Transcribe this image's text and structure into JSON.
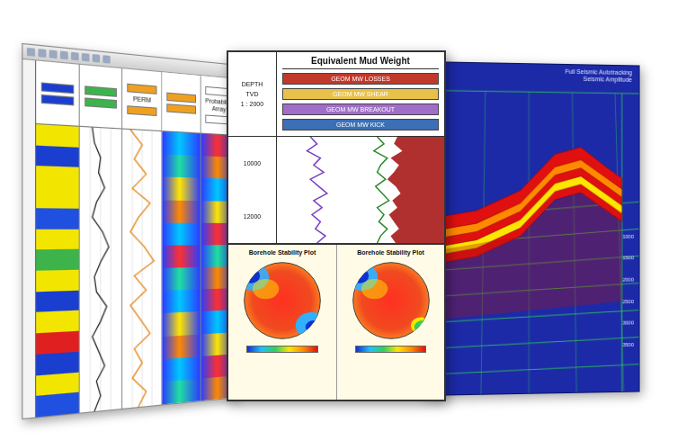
{
  "log_window": {
    "tracks": [
      {
        "kind": "facies",
        "label": "",
        "header_color": "#1a3fd0",
        "colors": [
          "#f2e600",
          "#1a3fd0",
          "#f2e600",
          "#f2e600",
          "#2050e0",
          "#f2e600",
          "#3cb44b",
          "#f2e600",
          "#1a3fd0",
          "#f2e600",
          "#e02020",
          "#1a3fd0",
          "#f2e600",
          "#2050e0"
        ]
      },
      {
        "kind": "curve",
        "label": "",
        "header_color": "#3cb44b",
        "color": "#222222",
        "values": [
          0.3,
          0.35,
          0.5,
          0.45,
          0.6,
          0.4,
          0.3,
          0.55,
          0.7,
          0.5,
          0.35,
          0.4,
          0.65,
          0.5,
          0.3,
          0.45,
          0.6,
          0.4,
          0.5,
          0.35
        ]
      },
      {
        "kind": "curve",
        "label": "PERM",
        "header_color": "#f0a020",
        "color": "#e07a00",
        "values": [
          0.2,
          0.5,
          0.3,
          0.6,
          0.25,
          0.7,
          0.4,
          0.2,
          0.55,
          0.8,
          0.3,
          0.6,
          0.2,
          0.45,
          0.7,
          0.3,
          0.5,
          0.25,
          0.6,
          0.4
        ]
      },
      {
        "kind": "heat",
        "label": "",
        "header_color": "#f0a020",
        "colors": [
          "#00c8ff",
          "#20e0a0",
          "#ffe600",
          "#ff8a00",
          "#00c8ff",
          "#ff3030",
          "#20e0a0",
          "#00c8ff",
          "#ffe600",
          "#ff8a00",
          "#00c8ff",
          "#20e0a0"
        ]
      },
      {
        "kind": "heat",
        "label": "Probability Array",
        "header_color": "#ffffff",
        "colors": [
          "#ff3030",
          "#ff8a00",
          "#00c8ff",
          "#ffe600",
          "#ff3030",
          "#20e0a0",
          "#ff8a00",
          "#ff3030",
          "#00c8ff",
          "#ffe600",
          "#ff3030",
          "#ff8a00"
        ]
      }
    ]
  },
  "mud_weight_window": {
    "title": "Equivalent Mud Weight",
    "depth_label": "DEPTH",
    "tvd_label": "TVD",
    "scale": "1 : 2000",
    "legend": [
      {
        "label": "GEOM MW LOSSES",
        "color": "#c0392b"
      },
      {
        "label": "GEOM MW SHEAR",
        "color": "#e8c14a"
      },
      {
        "label": "GEOM MW BREAKOUT",
        "color": "#a06ec8"
      },
      {
        "label": "GEOM MW KICK",
        "color": "#3b6fb6"
      }
    ],
    "depth_ticks": [
      "10000",
      "12000"
    ],
    "series": [
      {
        "kind": "fill",
        "color": "#b03030",
        "values": [
          0.72,
          0.7,
          0.75,
          0.68,
          0.73,
          0.7,
          0.66,
          0.71,
          0.74,
          0.69,
          0.72,
          0.67,
          0.7,
          0.73,
          0.68,
          0.71
        ]
      },
      {
        "kind": "line",
        "color": "#7b3fc4",
        "values": [
          0.2,
          0.24,
          0.18,
          0.26,
          0.22,
          0.28,
          0.2,
          0.25,
          0.3,
          0.22,
          0.27,
          0.21,
          0.26,
          0.23,
          0.29,
          0.24
        ]
      },
      {
        "kind": "line",
        "color": "#2d8a2d",
        "values": [
          0.6,
          0.64,
          0.58,
          0.66,
          0.62,
          0.6,
          0.65,
          0.59,
          0.63,
          0.67,
          0.6,
          0.64,
          0.61,
          0.66,
          0.62,
          0.6
        ]
      }
    ]
  },
  "stability_plots": [
    {
      "title": "Borehole Stability Plot"
    },
    {
      "title": "Borehole Stability Plot"
    }
  ],
  "seismic_window": {
    "title": "Full Seismic Autotracking",
    "subtitle": "Seismic Amplitude",
    "depth_ticks": [
      "1000",
      "1500",
      "2000",
      "2500",
      "3000",
      "3500"
    ],
    "layers": [
      "#e01010",
      "#ffe600",
      "#e01010",
      "#ff8a00",
      "#e01010"
    ]
  }
}
